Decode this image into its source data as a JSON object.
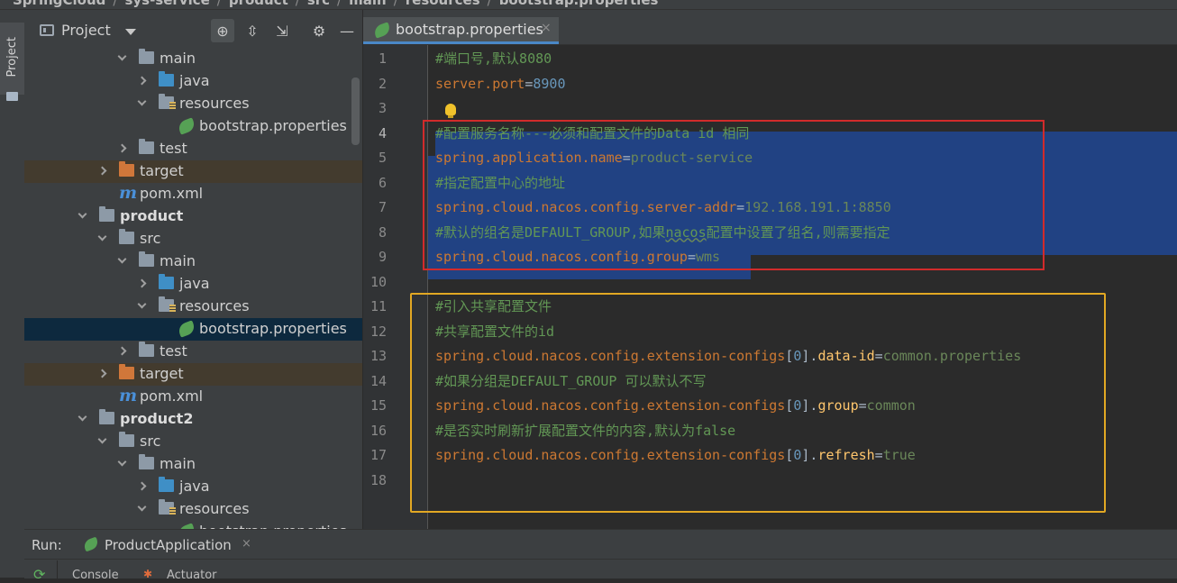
{
  "breadcrumb": [
    "SpringCloud",
    "sys-service",
    "product",
    "src",
    "main",
    "resources",
    "bootstrap.properties"
  ],
  "tool_stripe": {
    "project_label": "Project"
  },
  "project_panel": {
    "title": "Project",
    "tree": [
      {
        "label": "main",
        "icon": "folder-icon",
        "indent": 3,
        "arrow": "down"
      },
      {
        "label": "java",
        "icon": "source-folder-icon",
        "indent": 4,
        "arrow": "right"
      },
      {
        "label": "resources",
        "icon": "resources-folder-icon",
        "indent": 4,
        "arrow": "down"
      },
      {
        "label": "bootstrap.properties",
        "icon": "spring-properties-icon",
        "indent": 5,
        "arrow": ""
      },
      {
        "label": "test",
        "icon": "folder-icon",
        "indent": 3,
        "arrow": "right"
      },
      {
        "label": "target",
        "icon": "excluded-folder-icon",
        "indent": 2,
        "arrow": "right",
        "highlight": "target"
      },
      {
        "label": "pom.xml",
        "icon": "maven-icon",
        "indent": 2,
        "arrow": ""
      },
      {
        "label": "product",
        "icon": "module-folder-icon",
        "indent": 1,
        "arrow": "down",
        "bold": true
      },
      {
        "label": "src",
        "icon": "folder-icon",
        "indent": 2,
        "arrow": "down"
      },
      {
        "label": "main",
        "icon": "folder-icon",
        "indent": 3,
        "arrow": "down"
      },
      {
        "label": "java",
        "icon": "source-folder-icon",
        "indent": 4,
        "arrow": "right"
      },
      {
        "label": "resources",
        "icon": "resources-folder-icon",
        "indent": 4,
        "arrow": "down"
      },
      {
        "label": "bootstrap.properties",
        "icon": "spring-properties-icon",
        "indent": 5,
        "arrow": "",
        "highlight": "selected"
      },
      {
        "label": "test",
        "icon": "folder-icon",
        "indent": 3,
        "arrow": "right"
      },
      {
        "label": "target",
        "icon": "excluded-folder-icon",
        "indent": 2,
        "arrow": "right",
        "highlight": "target"
      },
      {
        "label": "pom.xml",
        "icon": "maven-icon",
        "indent": 2,
        "arrow": ""
      },
      {
        "label": "product2",
        "icon": "module-folder-icon",
        "indent": 1,
        "arrow": "down",
        "bold": true
      },
      {
        "label": "src",
        "icon": "folder-icon",
        "indent": 2,
        "arrow": "down"
      },
      {
        "label": "main",
        "icon": "folder-icon",
        "indent": 3,
        "arrow": "down"
      },
      {
        "label": "java",
        "icon": "source-folder-icon",
        "indent": 4,
        "arrow": "right"
      },
      {
        "label": "resources",
        "icon": "resources-folder-icon",
        "indent": 4,
        "arrow": "down"
      },
      {
        "label": "bootstrap.properties",
        "icon": "spring-properties-icon",
        "indent": 5,
        "arrow": ""
      }
    ]
  },
  "editor": {
    "tab_label": "bootstrap.properties",
    "current_line": 4,
    "lines": [
      [
        {
          "t": "comment",
          "v": "#端口号,默认8080"
        }
      ],
      [
        {
          "t": "key",
          "v": "server.port"
        },
        {
          "t": "eq",
          "v": "="
        },
        {
          "t": "val",
          "v": "8900"
        }
      ],
      [],
      [
        {
          "t": "comment",
          "v": "#配置服务名称---必须和配置文件的Data id 相同"
        }
      ],
      [
        {
          "t": "key",
          "v": "spring.application.name"
        },
        {
          "t": "eq",
          "v": "="
        },
        {
          "t": "str",
          "v": "product-service"
        }
      ],
      [
        {
          "t": "comment",
          "v": "#指定配置中心的地址"
        }
      ],
      [
        {
          "t": "key",
          "v": "spring.cloud.nacos.config.server-addr"
        },
        {
          "t": "eq",
          "v": "="
        },
        {
          "t": "str",
          "v": "192.168.191.1:8850"
        }
      ],
      [
        {
          "t": "comment",
          "v": "#默认的组名是DEFAULT_GROUP,如果"
        },
        {
          "t": "comment squig",
          "v": "nacos"
        },
        {
          "t": "comment",
          "v": "配置中设置了组名,则需要指定"
        }
      ],
      [
        {
          "t": "key",
          "v": "spring.cloud.nacos.config.group"
        },
        {
          "t": "eq",
          "v": "="
        },
        {
          "t": "str",
          "v": "wms"
        }
      ],
      [],
      [
        {
          "t": "comment",
          "v": "#引入共享配置文件"
        }
      ],
      [
        {
          "t": "comment",
          "v": "#共享配置文件的id"
        }
      ],
      [
        {
          "t": "key",
          "v": "spring.cloud.nacos.config.extension-configs"
        },
        {
          "t": "br",
          "v": "["
        },
        {
          "t": "val",
          "v": "0"
        },
        {
          "t": "br",
          "v": "]."
        },
        {
          "t": "sub",
          "v": "data-id"
        },
        {
          "t": "eq",
          "v": "="
        },
        {
          "t": "str",
          "v": "common.properties"
        }
      ],
      [
        {
          "t": "comment",
          "v": "#如果分组是DEFAULT_GROUP 可以默认不写"
        }
      ],
      [
        {
          "t": "key",
          "v": "spring.cloud.nacos.config.extension-configs"
        },
        {
          "t": "br",
          "v": "["
        },
        {
          "t": "val",
          "v": "0"
        },
        {
          "t": "br",
          "v": "]."
        },
        {
          "t": "sub",
          "v": "group"
        },
        {
          "t": "eq",
          "v": "="
        },
        {
          "t": "str",
          "v": "common"
        }
      ],
      [
        {
          "t": "comment",
          "v": "#是否实时刷新扩展配置文件的内容,默认为false"
        }
      ],
      [
        {
          "t": "key",
          "v": "spring.cloud.nacos.config.extension-configs"
        },
        {
          "t": "br",
          "v": "["
        },
        {
          "t": "val",
          "v": "0"
        },
        {
          "t": "br",
          "v": "]."
        },
        {
          "t": "sub",
          "v": "refresh"
        },
        {
          "t": "eq",
          "v": "="
        },
        {
          "t": "str",
          "v": "true"
        }
      ],
      []
    ]
  },
  "run_panel": {
    "label": "Run:",
    "config_name": "ProductApplication",
    "close_glyph": "×",
    "sub_tabs": [
      "Console",
      "Actuator"
    ]
  },
  "colors": {
    "selection": "#214283",
    "red_annotation": "#d22b2b",
    "yellow_annotation": "#e2a823",
    "comment": "#629755",
    "key": "#cc7832"
  }
}
